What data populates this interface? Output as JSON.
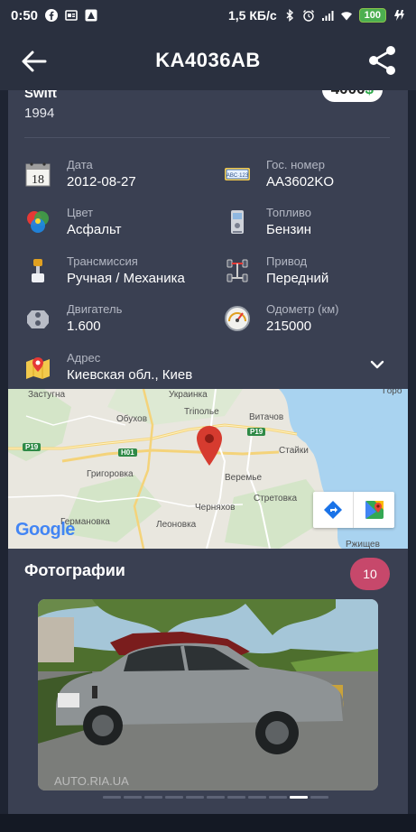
{
  "status": {
    "time": "0:50",
    "speed": "1,5 КБ/с",
    "battery": "100"
  },
  "header": {
    "title": "KA4036AB"
  },
  "car": {
    "model": "Swift",
    "year": "1994",
    "price_value": "4000",
    "price_currency": "$"
  },
  "fields": {
    "date": {
      "label": "Дата",
      "value": "2012-08-27",
      "icon": "calendar-icon"
    },
    "plate": {
      "label": "Гос. номер",
      "value": "AA3602KO",
      "icon": "license-plate-icon"
    },
    "color": {
      "label": "Цвет",
      "value": "Асфальт",
      "icon": "color-palette-icon"
    },
    "fuel": {
      "label": "Топливо",
      "value": "Бензин",
      "icon": "fuel-pump-icon"
    },
    "transmission": {
      "label": "Трансмиссия",
      "value": "Ручная / Механика",
      "icon": "gearbox-icon"
    },
    "drive": {
      "label": "Привод",
      "value": "Передний",
      "icon": "drivetrain-icon"
    },
    "engine": {
      "label": "Двигатель",
      "value": "1.600",
      "icon": "engine-icon"
    },
    "odometer": {
      "label": "Одометр (км)",
      "value": "215000",
      "icon": "odometer-icon"
    },
    "address": {
      "label": "Адрес",
      "value": "Киевская обл., Киев",
      "icon": "map-pin-icon"
    }
  },
  "map": {
    "labels": {
      "zastugna": "Застугна",
      "ukrainka": "Украинка",
      "obuhov": "Обухов",
      "tripolye": "Triполье",
      "vitachov": "Витачов",
      "grigorovka": "Григоровка",
      "veremye": "Веремье",
      "staiki": "Стайки",
      "stretovka": "Стретовка",
      "chernyahov": "Черняхов",
      "germanovka": "Германовка",
      "leonovka": "Леоновка",
      "rzhishchev": "Ржищев",
      "gorodok": "Горо"
    },
    "roads": {
      "p19a": "P19",
      "p19b": "P19",
      "h01": "H01"
    },
    "logo": "Google",
    "colors": {
      "pin": "#d63b2f",
      "water": "#a9d3f0",
      "green": "#cfe3c4"
    }
  },
  "photos": {
    "title": "Фотографии",
    "count": "10",
    "watermark": "AUTO.RIA.UA",
    "total_dots": 11,
    "active_dot": 9
  }
}
